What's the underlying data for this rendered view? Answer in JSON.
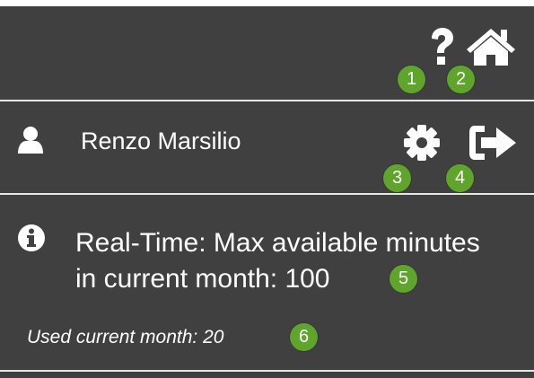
{
  "header": {
    "help_icon": "question-mark",
    "home_icon": "home",
    "help_badge": "1",
    "home_badge": "2"
  },
  "user": {
    "name": "Renzo Marsilio",
    "avatar_icon": "user",
    "settings_icon": "gear",
    "logout_icon": "sign-out",
    "settings_badge": "3",
    "logout_badge": "4"
  },
  "info": {
    "icon": "info-circle",
    "line1": "Real-Time: Max available minutes",
    "line2": "in current month: 100",
    "max_badge": "5",
    "used_label": "Used current month: 20",
    "used_badge": "6"
  },
  "colors": {
    "panel_background": "#404040",
    "badge": "#5fa52b",
    "text": "#ffffff",
    "divider": "#e6e6e6"
  }
}
